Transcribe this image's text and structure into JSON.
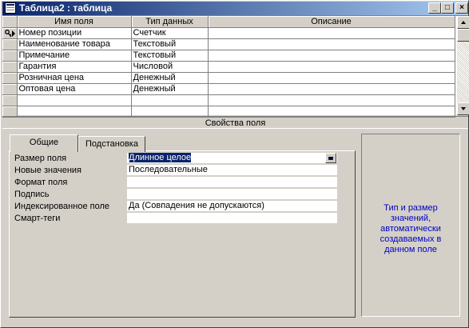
{
  "window": {
    "title": "Таблица2 : таблица",
    "buttons": {
      "minimize": "_",
      "maximize": "□",
      "close": "×"
    }
  },
  "grid": {
    "columns": [
      "Имя поля",
      "Тип данных",
      "Описание"
    ],
    "rows": [
      {
        "name": "Номер позиции",
        "type": "Счетчик",
        "description": "",
        "primary_key": true,
        "current": true
      },
      {
        "name": "Наименование товара",
        "type": "Текстовый",
        "description": ""
      },
      {
        "name": "Примечание",
        "type": "Текстовый",
        "description": ""
      },
      {
        "name": "Гарантия",
        "type": "Числовой",
        "description": ""
      },
      {
        "name": "Розничная цена",
        "type": "Денежный",
        "description": ""
      },
      {
        "name": "Оптовая цена",
        "type": "Денежный",
        "description": ""
      },
      {
        "name": "",
        "type": "",
        "description": ""
      },
      {
        "name": "",
        "type": "",
        "description": ""
      }
    ]
  },
  "properties": {
    "header": "Свойства поля",
    "tabs": {
      "general": "Общие",
      "lookup": "Подстановка",
      "active": "general"
    },
    "rows": [
      {
        "label": "Размер поля",
        "value": "Длинное целое",
        "dropdown": true,
        "selected": true
      },
      {
        "label": "Новые значения",
        "value": "Последовательные"
      },
      {
        "label": "Формат поля",
        "value": ""
      },
      {
        "label": "Подпись",
        "value": ""
      },
      {
        "label": "Индексированное поле",
        "value": "Да (Совпадения не допускаются)"
      },
      {
        "label": "Смарт-теги",
        "value": ""
      }
    ],
    "help": "Тип и размер значений, автоматически создаваемых в данном поле"
  },
  "colors": {
    "title_bar": "#0a246a",
    "face": "#d4d0c8",
    "help_text": "#0000c0",
    "selection": "#0a246a"
  }
}
